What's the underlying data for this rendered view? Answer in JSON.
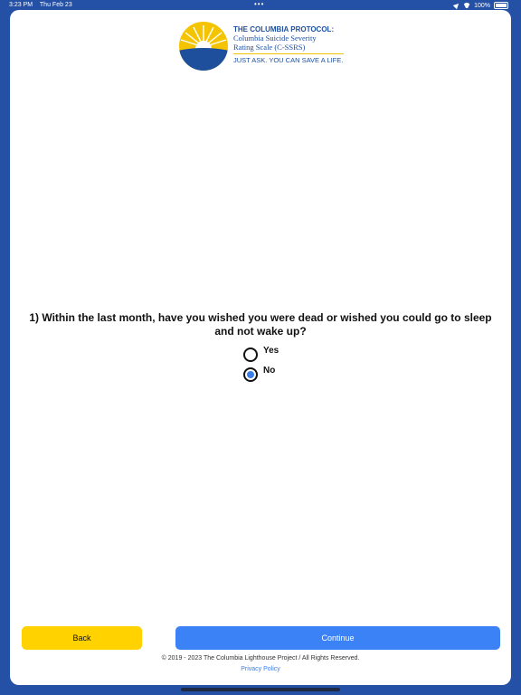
{
  "status_bar": {
    "time": "3:23 PM",
    "date": "Thu Feb 23",
    "dots": "•••",
    "battery": "100%"
  },
  "logo": {
    "title": "THE COLUMBIA PROTOCOL:",
    "subtitle_line1": "Columbia Suicide Severity",
    "subtitle_line2": "Rating Scale (C-SSRS)",
    "tagline": "JUST ASK. YOU CAN SAVE A LIFE.",
    "colors": {
      "sun": "#f5c400",
      "water": "#1e4f9c"
    }
  },
  "question": {
    "text": "1) Within the last month, have you wished you were dead or wished you could go to sleep and not wake up?",
    "options": [
      {
        "label": "Yes",
        "selected": false
      },
      {
        "label": "No",
        "selected": true
      }
    ]
  },
  "buttons": {
    "back": "Back",
    "continue": "Continue"
  },
  "footer": {
    "copyright": "© 2019 - 2023 The Columbia Lighthouse Project / All Rights Reserved.",
    "privacy": "Privacy Policy"
  },
  "colors": {
    "background": "#2450a6",
    "back_button": "#ffd200",
    "continue_button": "#3b82f6",
    "link": "#3b7de9"
  }
}
